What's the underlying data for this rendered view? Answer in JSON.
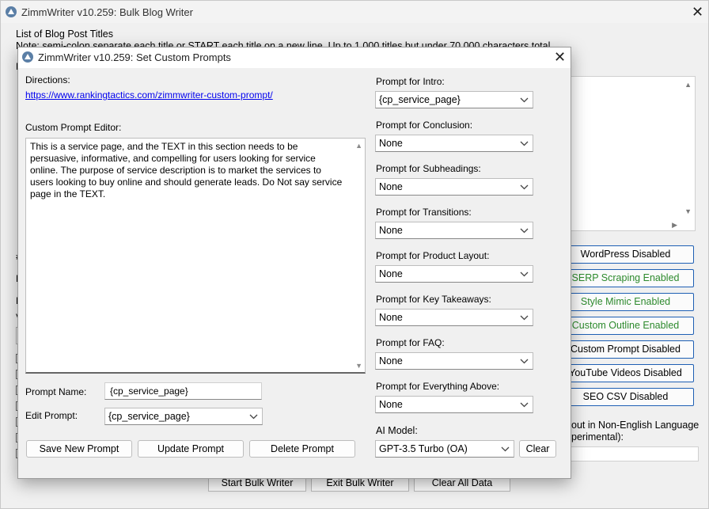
{
  "main": {
    "title": "ZimmWriter v10.259: Bulk Blog Writer",
    "list_label": "List of Blog Post Titles",
    "note": "Note: semi-colon separate each title or START each title on a new line. Up to 1,000 titles but under 70,000 characters total.",
    "side_buttons": [
      {
        "label": "WordPress Disabled",
        "color": "#000000"
      },
      {
        "label": "SERP Scraping Enabled",
        "color": "#2d8a2d"
      },
      {
        "label": "Style Mimic Enabled",
        "color": "#2d8a2d"
      },
      {
        "label": "Custom Outline Enabled",
        "color": "#2d8a2d"
      },
      {
        "label": "Custom Prompt Disabled",
        "color": "#000000"
      },
      {
        "label": "YouTube Videos Disabled",
        "color": "#000000"
      },
      {
        "label": "SEO CSV Disabled",
        "color": "#000000"
      }
    ],
    "language_label_1": "out in Non-English Language",
    "language_label_2": "perimental):",
    "bottom_buttons": [
      "Start Bulk Writer",
      "Exit Bulk Writer",
      "Clear All Data"
    ],
    "left_frags": [
      "D",
      "#",
      "H",
      "H",
      "V"
    ]
  },
  "dialog": {
    "title": "ZimmWriter v10.259: Set Custom Prompts",
    "directions_label": "Directions:",
    "directions_link": "https://www.rankingtactics.com/zimmwriter-custom-prompt/",
    "editor_label": "Custom Prompt Editor:",
    "editor_text": "This is a service page, and the TEXT in this section needs to be persuasive, informative, and compelling for users looking for service online. The purpose of service description is to market the services to users looking to buy online and should generate leads. Do Not say service page in the TEXT.",
    "prompt_name_label": "Prompt Name:",
    "prompt_name_value": "{cp_service_page}",
    "edit_prompt_label": "Edit Prompt:",
    "edit_prompt_value": "{cp_service_page}",
    "save_button": "Save New Prompt",
    "update_button": "Update Prompt",
    "delete_button": "Delete Prompt",
    "prompts": [
      {
        "label": "Prompt for Intro:",
        "value": "{cp_service_page}"
      },
      {
        "label": "Prompt for Conclusion:",
        "value": "None"
      },
      {
        "label": "Prompt for Subheadings:",
        "value": "None"
      },
      {
        "label": "Prompt for Transitions:",
        "value": "None"
      },
      {
        "label": "Prompt for Product Layout:",
        "value": "None"
      },
      {
        "label": "Prompt for Key Takeaways:",
        "value": "None"
      },
      {
        "label": "Prompt for FAQ:",
        "value": "None"
      },
      {
        "label": "Prompt for Everything Above:",
        "value": "None"
      }
    ],
    "ai_model_label": "AI Model:",
    "ai_model_value": "GPT-3.5 Turbo (OA)",
    "clear_button": "Clear"
  },
  "icons": {
    "app": "zimmwriter-app-icon",
    "close": "close-icon",
    "dropdown": "chevron-down-icon"
  },
  "colors": {
    "link": "#0000ee",
    "enabled_green": "#2d8a2d",
    "button_border_blue": "#1e5fb4"
  }
}
